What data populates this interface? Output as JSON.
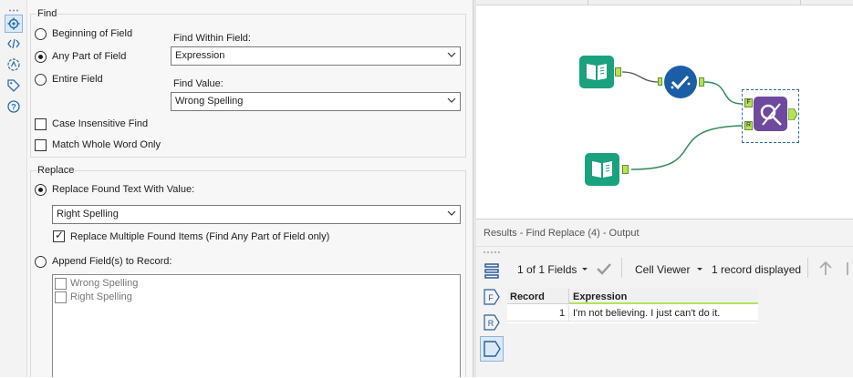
{
  "config": {
    "find_group_title": "Find",
    "radios": {
      "beginning": "Beginning of Field",
      "any_part": "Any Part of Field",
      "entire": "Entire Field"
    },
    "find_within_label": "Find Within Field:",
    "find_within_value": "Expression",
    "find_value_label": "Find Value:",
    "find_value_value": "Wrong Spelling",
    "case_insensitive": "Case Insensitive Find",
    "whole_word": "Match Whole Word Only",
    "replace_group_title": "Replace",
    "replace_found": "Replace Found Text With Value:",
    "replace_value": "Right Spelling",
    "replace_multiple": "Replace Multiple Found Items (Find Any Part of Field only)",
    "append_fields": "Append Field(s) to Record:",
    "append_list": [
      "Wrong Spelling",
      "Right Spelling"
    ]
  },
  "results": {
    "title": "Results - Find Replace (4) - Output",
    "fields_label": "1 of 1 Fields",
    "cell_viewer": "Cell Viewer",
    "records_displayed": "1 record displayed",
    "columns": [
      "Record",
      "Expression"
    ],
    "rows": [
      [
        "1",
        "I'm not believing. I just can't do it."
      ]
    ]
  },
  "colors": {
    "input_tool": "#1aa17e",
    "data_tool": "#1b5ea6",
    "find_replace_tool": "#6e4a9e",
    "connector": "#2e8b57",
    "anchor": "#b3e35a"
  }
}
